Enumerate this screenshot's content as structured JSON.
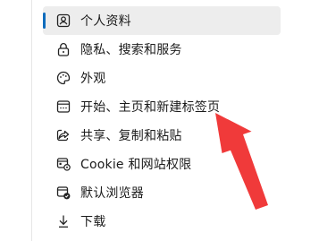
{
  "settings_nav": {
    "items": [
      {
        "label": "个人资料",
        "icon": "profile-icon",
        "selected": true
      },
      {
        "label": "隐私、搜索和服务",
        "icon": "lock-icon"
      },
      {
        "label": "外观",
        "icon": "appearance-icon"
      },
      {
        "label": "开始、主页和新建标签页",
        "icon": "start-home-icon"
      },
      {
        "label": "共享、复制和粘贴",
        "icon": "share-icon"
      },
      {
        "label": "Cookie 和网站权限",
        "icon": "site-permissions-icon"
      },
      {
        "label": "默认浏览器",
        "icon": "default-browser-icon"
      },
      {
        "label": "下载",
        "icon": "download-icon"
      }
    ]
  },
  "colors": {
    "accent": "#0f6cbd",
    "selected_bg": "#ededed",
    "annotation_arrow": "#f03a3a",
    "text": "#1b1b1b"
  }
}
